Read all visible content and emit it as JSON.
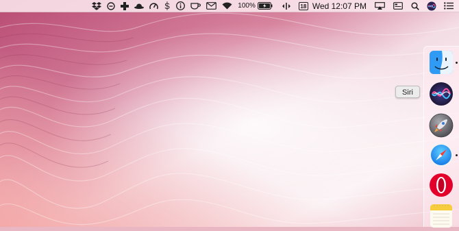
{
  "menubar": {
    "battery_percent": "100%",
    "calendar_day": "18",
    "clock": "Wed 12:07 PM",
    "icons": [
      "dropbox-icon",
      "timer-icon",
      "plus-icon",
      "bowler-hat-icon",
      "speedometer-icon",
      "dollar-icon",
      "info-icon",
      "coffee-icon",
      "mail-icon",
      "wifi-icon",
      "battery-icon",
      "expand-arrows-icon",
      "calendar-icon",
      "airplay-icon",
      "display-icon",
      "search-icon",
      "siri-icon",
      "notification-center-icon"
    ]
  },
  "tooltip": {
    "text": "Siri"
  },
  "dock": {
    "items": [
      {
        "name": "Finder",
        "running": true
      },
      {
        "name": "Siri",
        "running": false
      },
      {
        "name": "Launchpad",
        "running": false
      },
      {
        "name": "Safari",
        "running": true
      },
      {
        "name": "Opera",
        "running": false
      },
      {
        "name": "Notes",
        "running": false
      }
    ]
  },
  "colors": {
    "wallpaper_base": "#e9b6c4",
    "accent": "#c7366f"
  }
}
